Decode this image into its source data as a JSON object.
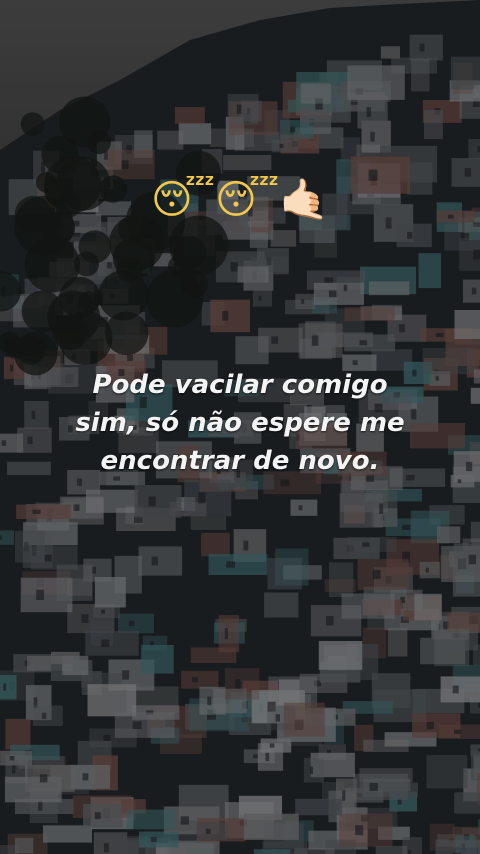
{
  "post": {
    "emojis": "😴😴🤙🏻",
    "caption_lines": [
      "Pode vacilar comigo",
      "sim, só não espere me",
      "encontrar de novo."
    ]
  },
  "background": {
    "subject": "favela-hillside-houses",
    "colors": {
      "sky": "#3c3c3c",
      "shadow": "#1e2326",
      "house_light": "#7a7d80",
      "house_brick": "#6a4a44",
      "house_teal": "#3f6a6e"
    }
  }
}
